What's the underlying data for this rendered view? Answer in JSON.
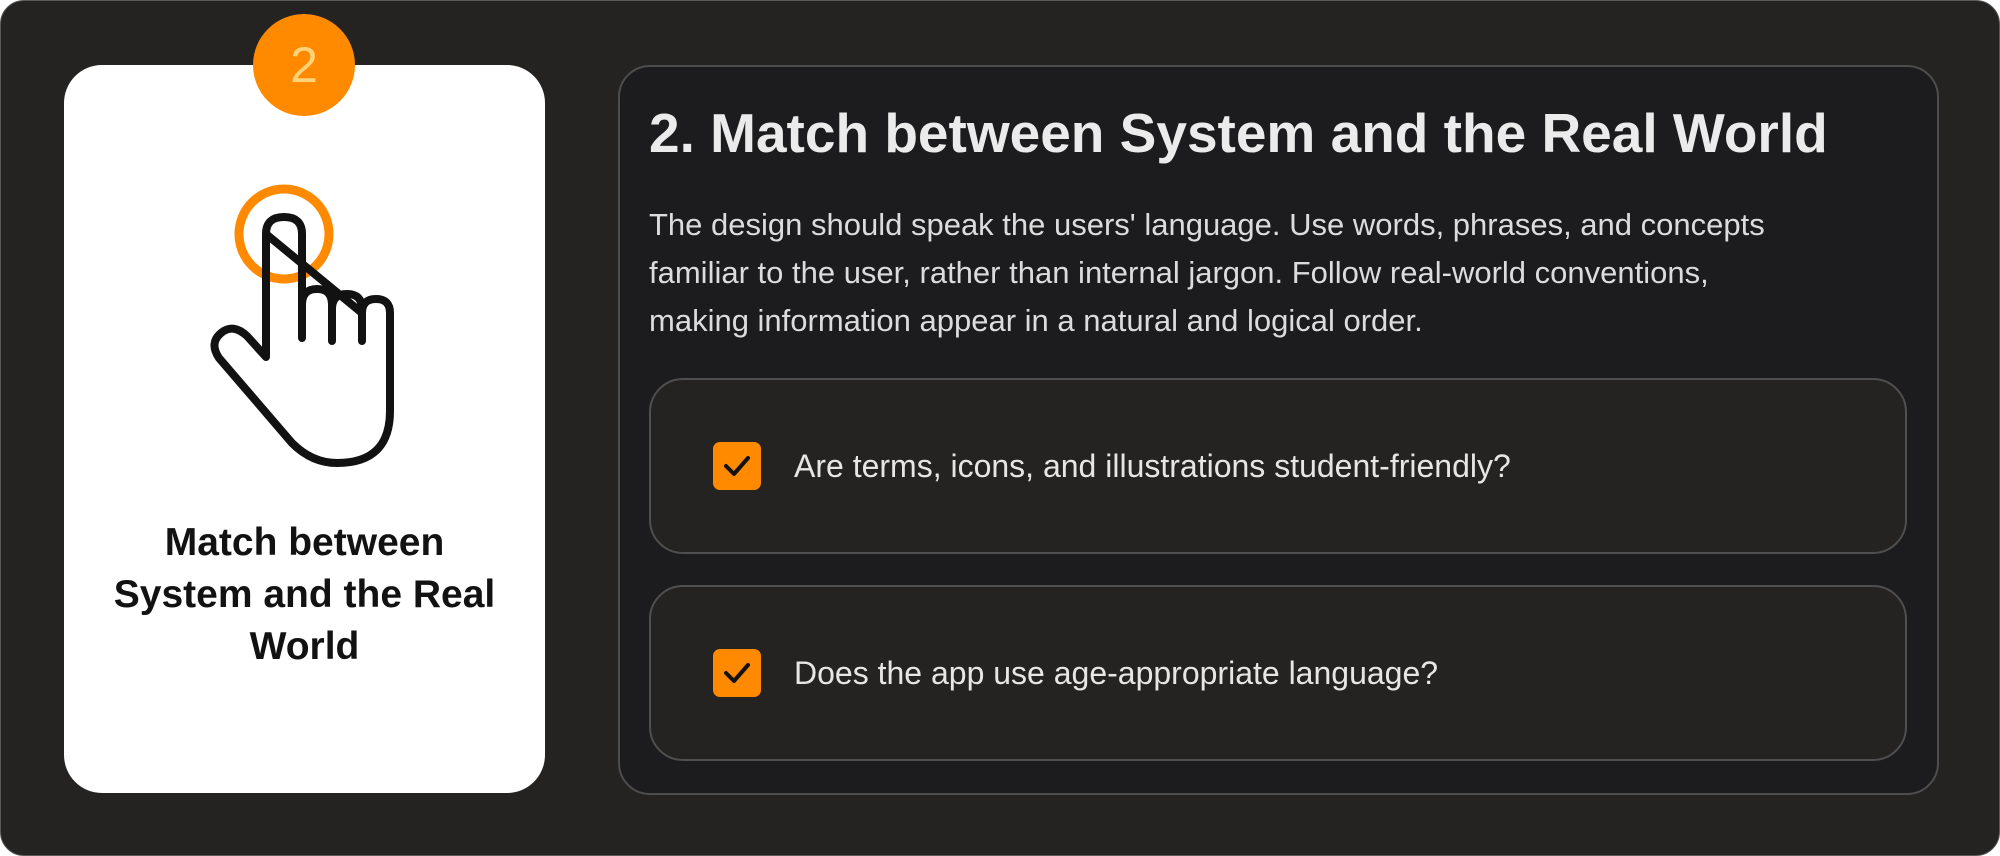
{
  "card": {
    "badge_number": "2",
    "icon": "pointing-hand-icon",
    "title_lines": [
      "Match between",
      "System and the Real",
      "World"
    ]
  },
  "panel": {
    "title": "2. Match between System and the Real World",
    "description_lines": [
      "The design should speak the users' language. Use words, phrases, and concepts",
      "familiar to the user, rather than internal jargon. Follow real-world conventions,",
      "making information appear in a natural and logical order."
    ],
    "checklist": [
      {
        "label": "Are terms, icons, and illustrations student-friendly?",
        "checked": true
      },
      {
        "label": "Does the app use age-appropriate language?",
        "checked": true
      }
    ]
  },
  "colors": {
    "accent": "#ff8a00",
    "background": "#242322",
    "panel": "#1c1c1e",
    "card": "#ffffff"
  }
}
